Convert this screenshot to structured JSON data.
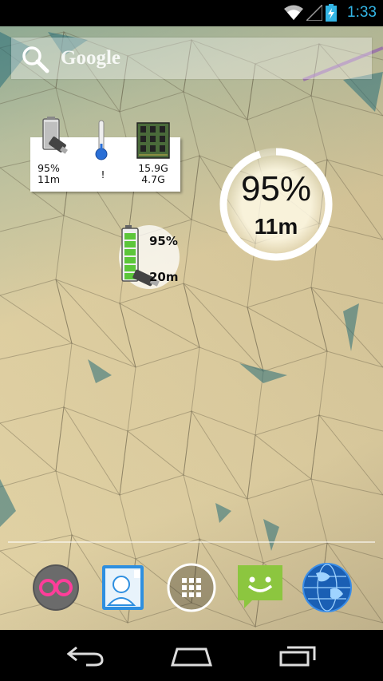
{
  "status_bar": {
    "time": "1:33",
    "icons": [
      "wifi-icon",
      "signal-icon",
      "battery-charging-icon"
    ],
    "accent_color": "#33b5e5"
  },
  "search": {
    "label": "Google",
    "icon": "search-icon"
  },
  "sysinfo_widget": {
    "battery": {
      "percent": "95%",
      "time": "11m",
      "icon": "usb-plug-battery-icon"
    },
    "temperature": {
      "value": "!",
      "icon": "thermometer-icon"
    },
    "memory": {
      "total": "15.9G",
      "free": "4.7G",
      "icon": "ram-chip-icon"
    }
  },
  "ring_widget": {
    "percent": "95%",
    "time": "11m",
    "level_fraction": 0.95
  },
  "battery_widget": {
    "percent": "95%",
    "time": "20m",
    "level_fraction": 0.95
  },
  "dock": {
    "apps": [
      "flickr-app-icon",
      "contacts-app-icon",
      "app-drawer-icon",
      "messaging-app-icon",
      "browser-globe-icon"
    ]
  },
  "nav_bar": {
    "buttons": [
      "back-icon",
      "home-icon",
      "recent-apps-icon"
    ]
  }
}
